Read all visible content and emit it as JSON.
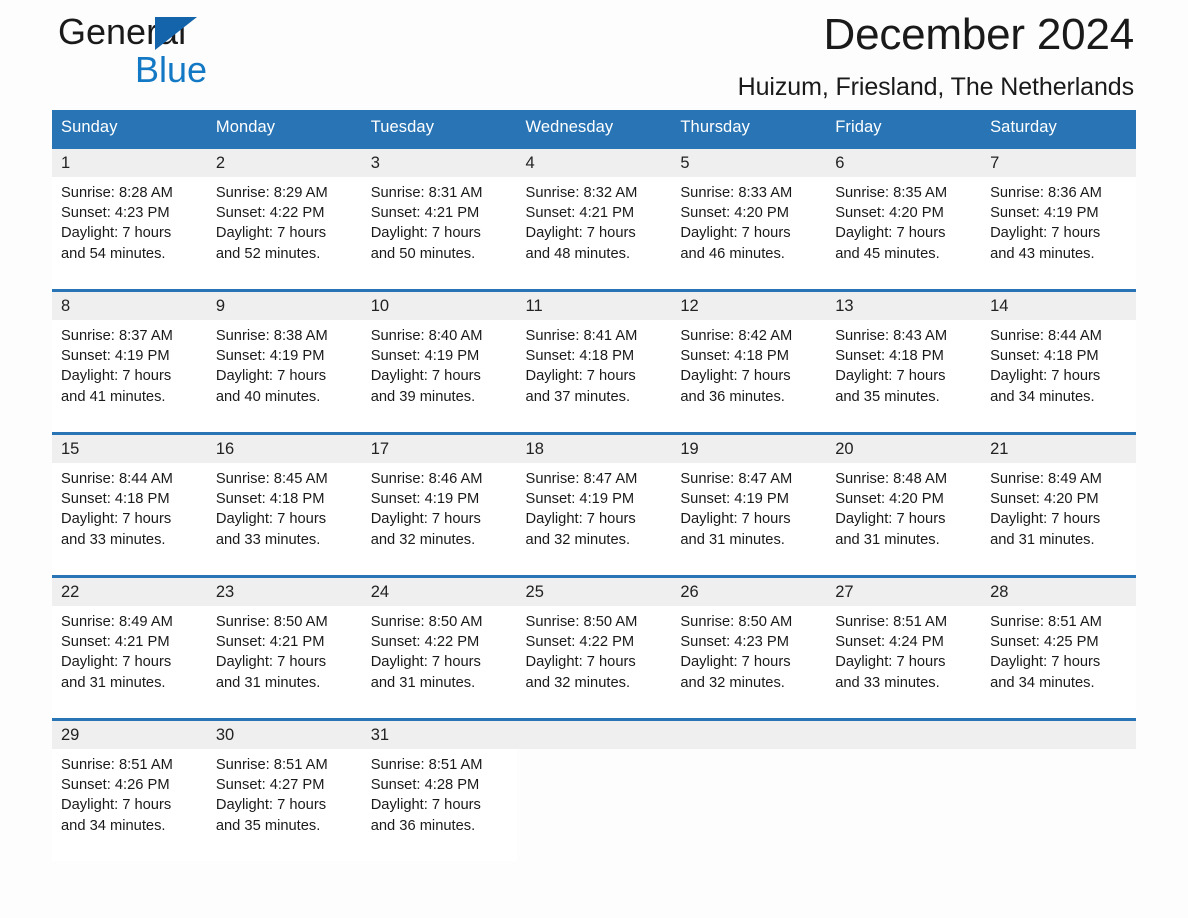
{
  "brand": {
    "name_part1": "General",
    "name_part2": "Blue",
    "triangle_color": "#1464ab",
    "blue_color": "#1479c4"
  },
  "header": {
    "title": "December 2024",
    "location": "Huizum, Friesland, The Netherlands"
  },
  "theme": {
    "header_blue": "#2874b4",
    "daynum_band": "#efefef",
    "cell_background": "#ffffff",
    "page_background": "#fdfdfd"
  },
  "calendar": {
    "weekday_headers": [
      "Sunday",
      "Monday",
      "Tuesday",
      "Wednesday",
      "Thursday",
      "Friday",
      "Saturday"
    ],
    "labels": {
      "sunrise": "Sunrise:",
      "sunset": "Sunset:",
      "daylight": "Daylight:"
    },
    "weeks": [
      [
        {
          "day": "1",
          "sunrise": "Sunrise: 8:28 AM",
          "sunset": "Sunset: 4:23 PM",
          "daylight_line1": "Daylight: 7 hours",
          "daylight_line2": "and 54 minutes."
        },
        {
          "day": "2",
          "sunrise": "Sunrise: 8:29 AM",
          "sunset": "Sunset: 4:22 PM",
          "daylight_line1": "Daylight: 7 hours",
          "daylight_line2": "and 52 minutes."
        },
        {
          "day": "3",
          "sunrise": "Sunrise: 8:31 AM",
          "sunset": "Sunset: 4:21 PM",
          "daylight_line1": "Daylight: 7 hours",
          "daylight_line2": "and 50 minutes."
        },
        {
          "day": "4",
          "sunrise": "Sunrise: 8:32 AM",
          "sunset": "Sunset: 4:21 PM",
          "daylight_line1": "Daylight: 7 hours",
          "daylight_line2": "and 48 minutes."
        },
        {
          "day": "5",
          "sunrise": "Sunrise: 8:33 AM",
          "sunset": "Sunset: 4:20 PM",
          "daylight_line1": "Daylight: 7 hours",
          "daylight_line2": "and 46 minutes."
        },
        {
          "day": "6",
          "sunrise": "Sunrise: 8:35 AM",
          "sunset": "Sunset: 4:20 PM",
          "daylight_line1": "Daylight: 7 hours",
          "daylight_line2": "and 45 minutes."
        },
        {
          "day": "7",
          "sunrise": "Sunrise: 8:36 AM",
          "sunset": "Sunset: 4:19 PM",
          "daylight_line1": "Daylight: 7 hours",
          "daylight_line2": "and 43 minutes."
        }
      ],
      [
        {
          "day": "8",
          "sunrise": "Sunrise: 8:37 AM",
          "sunset": "Sunset: 4:19 PM",
          "daylight_line1": "Daylight: 7 hours",
          "daylight_line2": "and 41 minutes."
        },
        {
          "day": "9",
          "sunrise": "Sunrise: 8:38 AM",
          "sunset": "Sunset: 4:19 PM",
          "daylight_line1": "Daylight: 7 hours",
          "daylight_line2": "and 40 minutes."
        },
        {
          "day": "10",
          "sunrise": "Sunrise: 8:40 AM",
          "sunset": "Sunset: 4:19 PM",
          "daylight_line1": "Daylight: 7 hours",
          "daylight_line2": "and 39 minutes."
        },
        {
          "day": "11",
          "sunrise": "Sunrise: 8:41 AM",
          "sunset": "Sunset: 4:18 PM",
          "daylight_line1": "Daylight: 7 hours",
          "daylight_line2": "and 37 minutes."
        },
        {
          "day": "12",
          "sunrise": "Sunrise: 8:42 AM",
          "sunset": "Sunset: 4:18 PM",
          "daylight_line1": "Daylight: 7 hours",
          "daylight_line2": "and 36 minutes."
        },
        {
          "day": "13",
          "sunrise": "Sunrise: 8:43 AM",
          "sunset": "Sunset: 4:18 PM",
          "daylight_line1": "Daylight: 7 hours",
          "daylight_line2": "and 35 minutes."
        },
        {
          "day": "14",
          "sunrise": "Sunrise: 8:44 AM",
          "sunset": "Sunset: 4:18 PM",
          "daylight_line1": "Daylight: 7 hours",
          "daylight_line2": "and 34 minutes."
        }
      ],
      [
        {
          "day": "15",
          "sunrise": "Sunrise: 8:44 AM",
          "sunset": "Sunset: 4:18 PM",
          "daylight_line1": "Daylight: 7 hours",
          "daylight_line2": "and 33 minutes."
        },
        {
          "day": "16",
          "sunrise": "Sunrise: 8:45 AM",
          "sunset": "Sunset: 4:18 PM",
          "daylight_line1": "Daylight: 7 hours",
          "daylight_line2": "and 33 minutes."
        },
        {
          "day": "17",
          "sunrise": "Sunrise: 8:46 AM",
          "sunset": "Sunset: 4:19 PM",
          "daylight_line1": "Daylight: 7 hours",
          "daylight_line2": "and 32 minutes."
        },
        {
          "day": "18",
          "sunrise": "Sunrise: 8:47 AM",
          "sunset": "Sunset: 4:19 PM",
          "daylight_line1": "Daylight: 7 hours",
          "daylight_line2": "and 32 minutes."
        },
        {
          "day": "19",
          "sunrise": "Sunrise: 8:47 AM",
          "sunset": "Sunset: 4:19 PM",
          "daylight_line1": "Daylight: 7 hours",
          "daylight_line2": "and 31 minutes."
        },
        {
          "day": "20",
          "sunrise": "Sunrise: 8:48 AM",
          "sunset": "Sunset: 4:20 PM",
          "daylight_line1": "Daylight: 7 hours",
          "daylight_line2": "and 31 minutes."
        },
        {
          "day": "21",
          "sunrise": "Sunrise: 8:49 AM",
          "sunset": "Sunset: 4:20 PM",
          "daylight_line1": "Daylight: 7 hours",
          "daylight_line2": "and 31 minutes."
        }
      ],
      [
        {
          "day": "22",
          "sunrise": "Sunrise: 8:49 AM",
          "sunset": "Sunset: 4:21 PM",
          "daylight_line1": "Daylight: 7 hours",
          "daylight_line2": "and 31 minutes."
        },
        {
          "day": "23",
          "sunrise": "Sunrise: 8:50 AM",
          "sunset": "Sunset: 4:21 PM",
          "daylight_line1": "Daylight: 7 hours",
          "daylight_line2": "and 31 minutes."
        },
        {
          "day": "24",
          "sunrise": "Sunrise: 8:50 AM",
          "sunset": "Sunset: 4:22 PM",
          "daylight_line1": "Daylight: 7 hours",
          "daylight_line2": "and 31 minutes."
        },
        {
          "day": "25",
          "sunrise": "Sunrise: 8:50 AM",
          "sunset": "Sunset: 4:22 PM",
          "daylight_line1": "Daylight: 7 hours",
          "daylight_line2": "and 32 minutes."
        },
        {
          "day": "26",
          "sunrise": "Sunrise: 8:50 AM",
          "sunset": "Sunset: 4:23 PM",
          "daylight_line1": "Daylight: 7 hours",
          "daylight_line2": "and 32 minutes."
        },
        {
          "day": "27",
          "sunrise": "Sunrise: 8:51 AM",
          "sunset": "Sunset: 4:24 PM",
          "daylight_line1": "Daylight: 7 hours",
          "daylight_line2": "and 33 minutes."
        },
        {
          "day": "28",
          "sunrise": "Sunrise: 8:51 AM",
          "sunset": "Sunset: 4:25 PM",
          "daylight_line1": "Daylight: 7 hours",
          "daylight_line2": "and 34 minutes."
        }
      ],
      [
        {
          "day": "29",
          "sunrise": "Sunrise: 8:51 AM",
          "sunset": "Sunset: 4:26 PM",
          "daylight_line1": "Daylight: 7 hours",
          "daylight_line2": "and 34 minutes."
        },
        {
          "day": "30",
          "sunrise": "Sunrise: 8:51 AM",
          "sunset": "Sunset: 4:27 PM",
          "daylight_line1": "Daylight: 7 hours",
          "daylight_line2": "and 35 minutes."
        },
        {
          "day": "31",
          "sunrise": "Sunrise: 8:51 AM",
          "sunset": "Sunset: 4:28 PM",
          "daylight_line1": "Daylight: 7 hours",
          "daylight_line2": "and 36 minutes."
        },
        {
          "day": "",
          "sunrise": "",
          "sunset": "",
          "daylight_line1": "",
          "daylight_line2": ""
        },
        {
          "day": "",
          "sunrise": "",
          "sunset": "",
          "daylight_line1": "",
          "daylight_line2": ""
        },
        {
          "day": "",
          "sunrise": "",
          "sunset": "",
          "daylight_line1": "",
          "daylight_line2": ""
        },
        {
          "day": "",
          "sunrise": "",
          "sunset": "",
          "daylight_line1": "",
          "daylight_line2": ""
        }
      ]
    ]
  }
}
